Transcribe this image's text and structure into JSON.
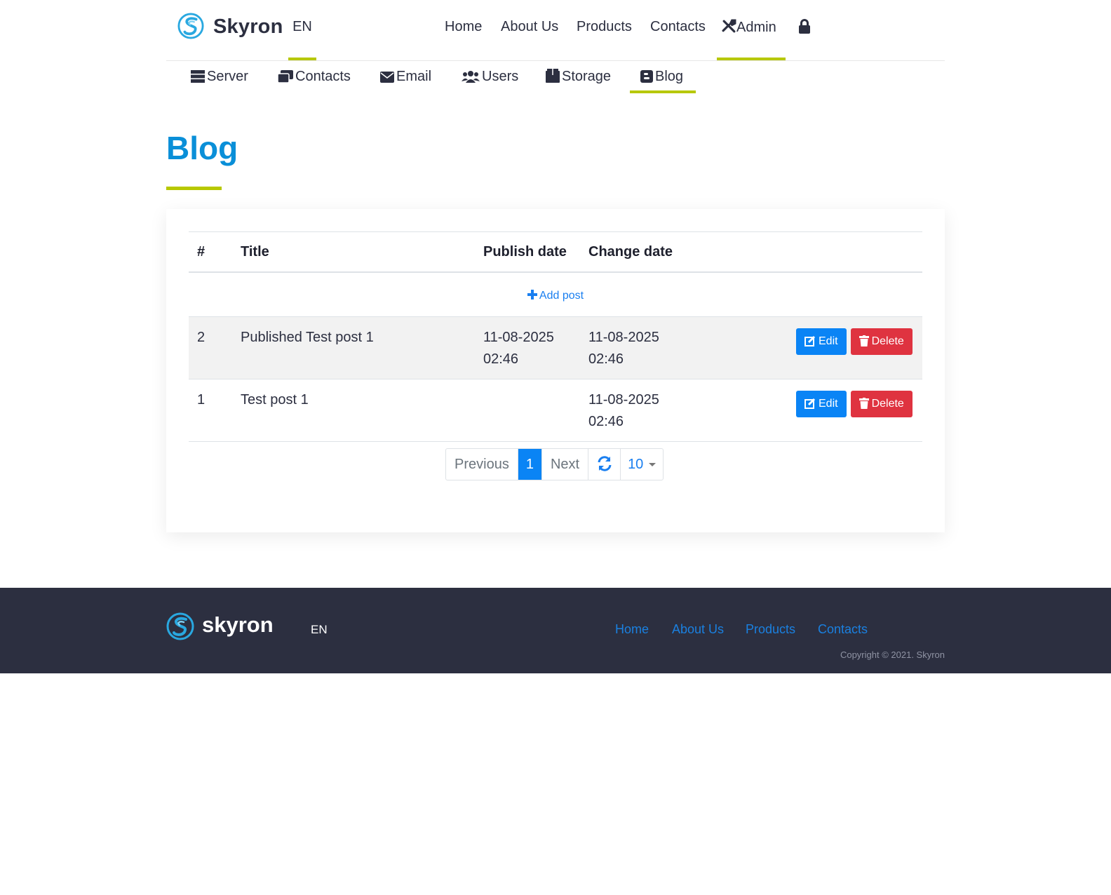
{
  "header": {
    "brand": "Skyron",
    "lang": "EN",
    "menu": [
      {
        "label": "Home"
      },
      {
        "label": "About Us"
      },
      {
        "label": "Products"
      },
      {
        "label": "Contacts"
      },
      {
        "label": "Admin"
      }
    ]
  },
  "subnav": [
    {
      "label": "Server"
    },
    {
      "label": "Contacts"
    },
    {
      "label": "Email"
    },
    {
      "label": "Users"
    },
    {
      "label": "Storage"
    },
    {
      "label": "Blog"
    }
  ],
  "page": {
    "title": "Blog"
  },
  "table": {
    "headers": [
      "#",
      "Title",
      "Publish date",
      "Change date"
    ],
    "add_label": "Add post",
    "edit_label": "Edit",
    "delete_label": "Delete",
    "rows": [
      {
        "id": "2",
        "title": "Published Test post 1",
        "publish_date": "11-08-2025",
        "publish_time": "02:46",
        "change_date": "11-08-2025",
        "change_time": "02:46"
      },
      {
        "id": "1",
        "title": "Test post 1",
        "publish_date": "",
        "publish_time": "",
        "change_date": "11-08-2025",
        "change_time": "02:46"
      }
    ]
  },
  "pagination": {
    "previous": "Previous",
    "current": "1",
    "next": "Next",
    "page_size": "10"
  },
  "footer": {
    "brand": "skyron",
    "lang": "EN",
    "links": [
      "Home",
      "About Us",
      "Products",
      "Contacts"
    ],
    "copyright": "Copyright © 2021. Skyron"
  },
  "colors": {
    "accent": "#b7c800",
    "title": "#0a8fd8",
    "primary": "#0a84f5",
    "danger": "#df3340",
    "footer_bg": "#2c2f40"
  }
}
